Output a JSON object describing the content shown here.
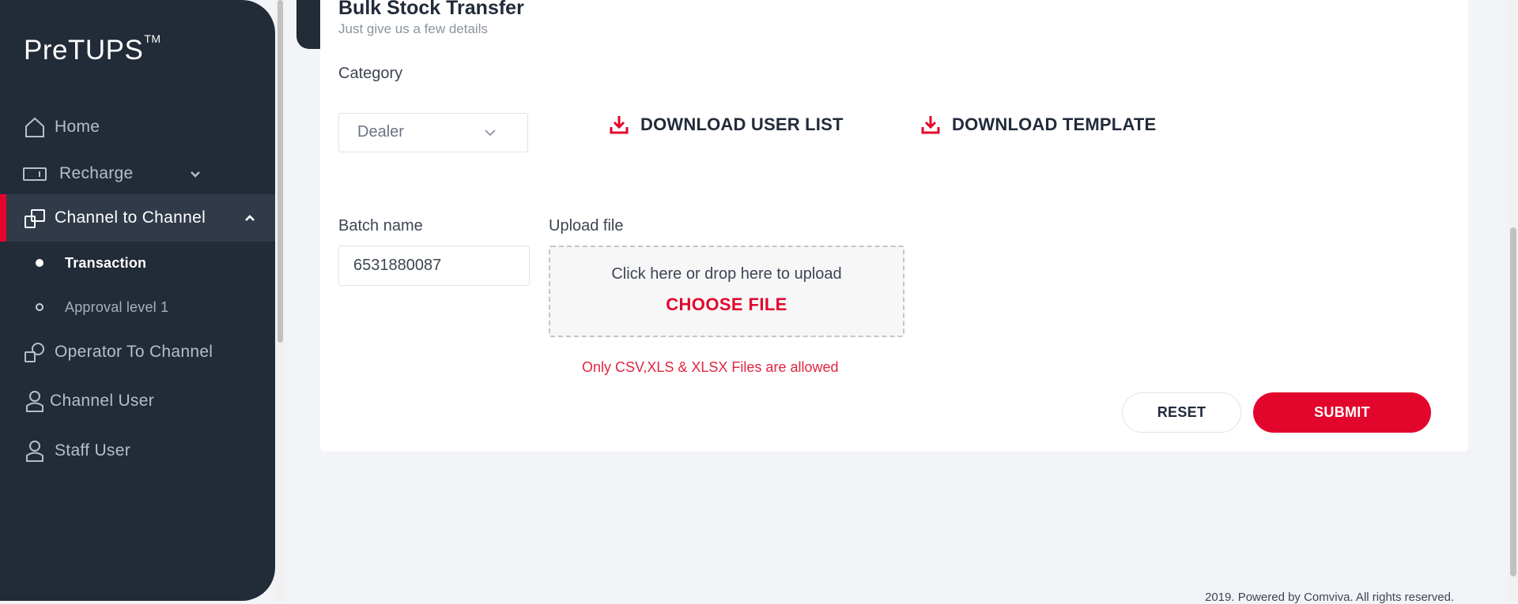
{
  "app": {
    "brand": "PreTUPS",
    "brand_mark": "TM"
  },
  "sidebar": {
    "items": [
      {
        "label": "Home",
        "icon": "home-icon"
      },
      {
        "label": "Recharge",
        "icon": "recharge-icon"
      },
      {
        "label": "Channel to Channel",
        "icon": "channel-transfer-icon"
      },
      {
        "label": "Operator To Channel",
        "icon": "operator-transfer-icon"
      },
      {
        "label": "Channel User",
        "icon": "user-icon"
      },
      {
        "label": "Staff User",
        "icon": "user-icon"
      }
    ],
    "sub_items": [
      {
        "label": "Transaction",
        "state": "current"
      },
      {
        "label": "Approval level 1",
        "state": "other"
      }
    ]
  },
  "page": {
    "title": "Bulk Stock Transfer",
    "subtitle": "Just give us a few details"
  },
  "form": {
    "category_label": "Category",
    "category_value": "Dealer",
    "download_user_list": "DOWNLOAD USER LIST",
    "download_template": "DOWNLOAD TEMPLATE",
    "batch_name_label": "Batch name",
    "batch_name_value": "6531880087",
    "upload_label": "Upload file",
    "upload_hint": "Click here or drop here to upload",
    "choose_file": "CHOOSE FILE",
    "file_note": "Only CSV,XLS & XLSX Files are allowed",
    "reset_label": "RESET",
    "submit_label": "SUBMIT"
  },
  "footer": {
    "text": "2019. Powered by Comviva. All rights reserved."
  },
  "colors": {
    "accent": "#e3062c",
    "sidebar_bg": "#222b38",
    "page_bg": "#f3f4f7"
  }
}
